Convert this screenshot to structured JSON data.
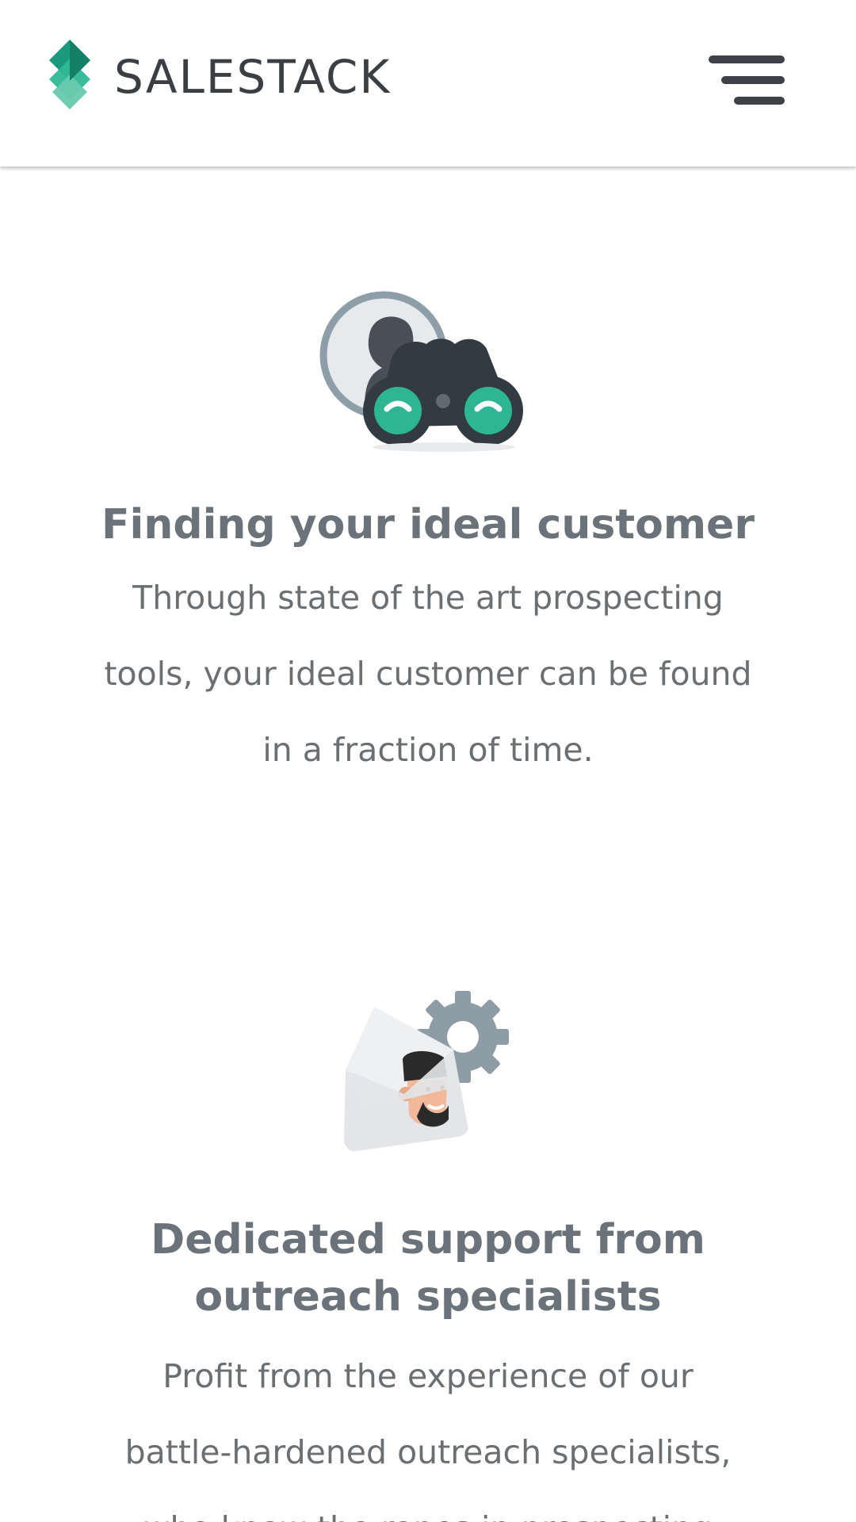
{
  "header": {
    "brand_name": "SALESTACK",
    "brand_icon": "salestack-logo-icon",
    "menu_icon": "hamburger-menu-icon"
  },
  "features": [
    {
      "icon": "binoculars-icon",
      "title": "Finding your ideal customer",
      "description": "Through state of the art prospecting tools, your ideal customer can be found in a fraction of time."
    },
    {
      "icon": "envelope-support-icon",
      "title": "Dedicated support from outreach specialists",
      "description": "Profit from the experience of our battle-hardened outreach specialists, who know the ropes in prospecting"
    }
  ],
  "colors": {
    "brand_teal": "#1fa888",
    "brand_teal_light": "#5ec7a8",
    "text_dark": "#3b3f44",
    "title_gray": "#6a727a",
    "desc_gray": "#6c6f72"
  }
}
